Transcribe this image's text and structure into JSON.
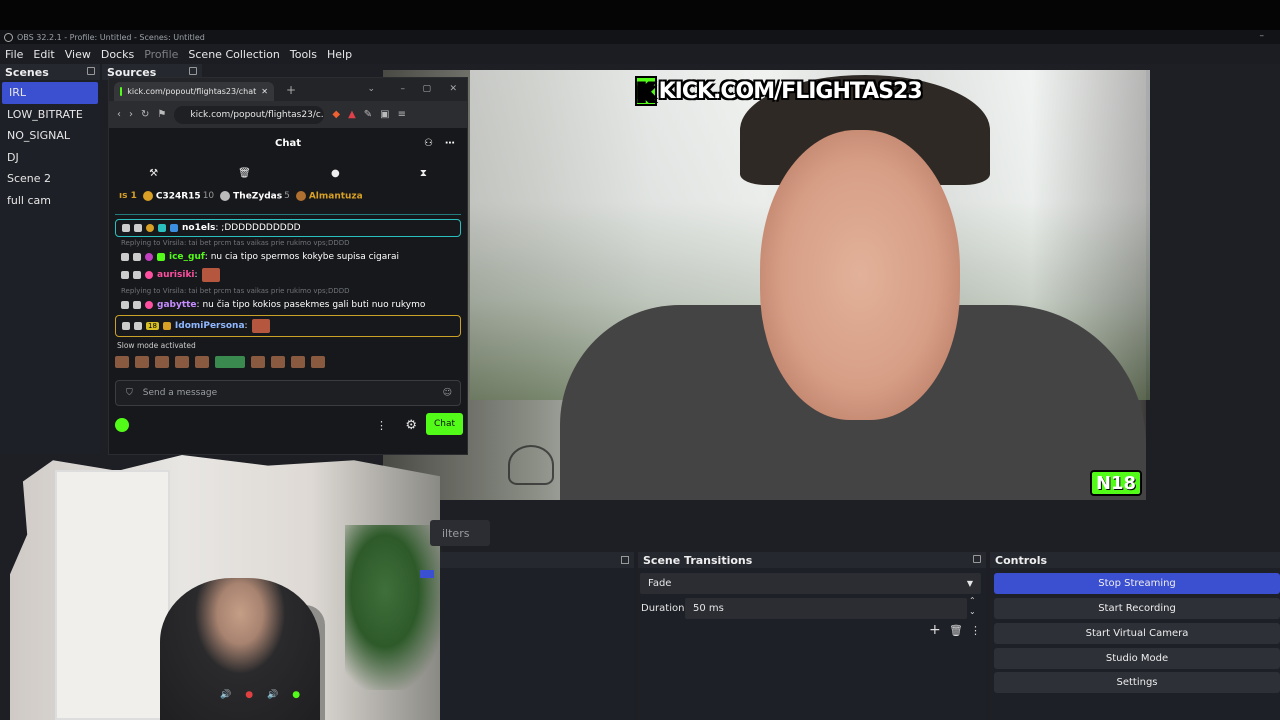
{
  "titlebar": {
    "text": "OBS 32.2.1 - Profile: Untitled - Scenes: Untitled"
  },
  "menu": [
    "File",
    "Edit",
    "View",
    "Docks",
    "Profile",
    "Scene Collection",
    "Tools",
    "Help"
  ],
  "scenes": {
    "title": "Scenes",
    "items": [
      {
        "label": "IRL",
        "selected": true
      },
      {
        "label": "LOW_BITRATE"
      },
      {
        "label": "NO_SIGNAL"
      },
      {
        "label": "DJ"
      },
      {
        "label": "Scene 2"
      },
      {
        "label": "full cam"
      }
    ]
  },
  "sources": {
    "title": "Sources"
  },
  "browser": {
    "tab_title": "kick.com/popout/flightas23/chat",
    "url": "kick.com/popout/flightas23/c...",
    "chat_title": "Chat",
    "leaders": [
      {
        "prefix": "ıs 1"
      },
      {
        "rank": "1",
        "name": "C324R15",
        "count": "10"
      },
      {
        "rank": "2",
        "name": "TheZydas",
        "count": "5"
      },
      {
        "rank": "3",
        "name": "Almantuza"
      }
    ],
    "messages": [
      {
        "user": "no1els",
        "text": ": ;DDDDDDDDDDD",
        "color": "#ffffff"
      },
      {
        "reply": "Replying to Virsila: tai bet prcm tas vaikas prie rukimo vps;DDDD"
      },
      {
        "user": "ice_guf",
        "text": ": nu cia tipo spermos kokybe supisa cigarai",
        "color": "#53fc18"
      },
      {
        "user": "aurisiki",
        "text": ":",
        "color": "#ff4fa0"
      },
      {
        "reply": "Replying to Virsila: tai bet prcm tas vaikas prie rukimo vps;DDDD"
      },
      {
        "user": "gabytte",
        "text": ": nu čia tipo kokios pasekmes gali buti nuo rukymo",
        "color": "#c48cff"
      },
      {
        "user": "IdomiPersona",
        "text": ":",
        "color": "#8fb8ff",
        "badge": "18"
      }
    ],
    "slow_mode": "Slow mode activated",
    "input_placeholder": "Send a message",
    "chat_button": "Chat"
  },
  "overlay": {
    "kick_text": "KICK.COM/FLIGHTAS23",
    "k": "K",
    "age": "N18"
  },
  "filters_tab": "ilters",
  "transitions": {
    "title": "Scene Transitions",
    "type": "Fade",
    "duration_label": "Duration",
    "duration_value": "50 ms"
  },
  "controls": {
    "title": "Controls",
    "buttons": [
      "Stop Streaming",
      "Start Recording",
      "Start Virtual Camera",
      "Studio Mode",
      "Settings"
    ]
  },
  "colors": {
    "accent": "#3b4fd1",
    "kick_green": "#53fc18"
  }
}
